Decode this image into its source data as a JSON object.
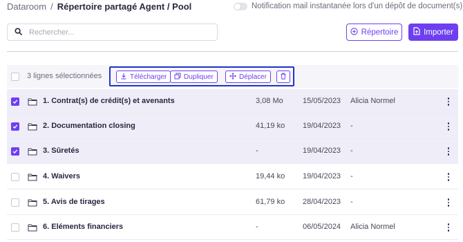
{
  "breadcrumb": {
    "root": "Dataroom",
    "separator": "/",
    "current": "Répertoire partagé Agent / Pool"
  },
  "notification": {
    "label": "Notification mail instantanée lors d'un dépôt de document(s)",
    "enabled": false
  },
  "search": {
    "placeholder": "Rechercher..."
  },
  "buttons": {
    "repertoire": "Répertoire",
    "importer": "Importer"
  },
  "colors": {
    "accent": "#6e3ff0",
    "highlight_border": "#1f35c8",
    "selected_row": "#efedf8"
  },
  "toolbar": {
    "selection_label": "3 lignes sélectionnées",
    "actions": [
      {
        "label": "Télécharger",
        "icon": "download-icon"
      },
      {
        "label": "Dupliquer",
        "icon": "duplicate-icon"
      },
      {
        "label": "Déplacer",
        "icon": "move-icon"
      },
      {
        "label": "",
        "icon": "trash-icon"
      }
    ]
  },
  "rows": [
    {
      "name": "1. Contrat(s) de crédit(s) et avenants",
      "size": "3,08 Mo",
      "date": "15/05/2023",
      "owner": "Alicia Normel",
      "selected": true
    },
    {
      "name": "2. Documentation closing",
      "size": "41,19 ko",
      "date": "19/04/2023",
      "owner": "-",
      "selected": true
    },
    {
      "name": "3. Sûretés",
      "size": "-",
      "date": "19/04/2023",
      "owner": "-",
      "selected": true
    },
    {
      "name": "4. Waivers",
      "size": "19,44 ko",
      "date": "19/04/2023",
      "owner": "-",
      "selected": false
    },
    {
      "name": "5. Avis de tirages",
      "size": "61,79 ko",
      "date": "28/04/2023",
      "owner": "-",
      "selected": false
    },
    {
      "name": "6. Eléments financiers",
      "size": "-",
      "date": "06/05/2024",
      "owner": "Alicia Normel",
      "selected": false
    }
  ]
}
